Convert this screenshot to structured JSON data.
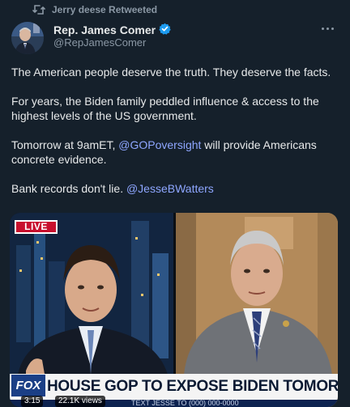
{
  "retweet": {
    "label": "Jerry deese Retweeted",
    "icon": "retweet-icon"
  },
  "author": {
    "name": "Rep. James Comer",
    "handle": "@RepJamesComer",
    "verified_icon": "verified-badge-icon",
    "verified_color": "#1d9bf0"
  },
  "tweet": {
    "paragraph1": "The American people deserve the truth. They deserve the facts.",
    "paragraph2": "For years, the Biden family peddled influence & access to the highest levels of the US government.",
    "paragraph3_prefix": "Tomorrow at 9amET, ",
    "paragraph3_mention": "@GOPoversight",
    "paragraph3_suffix": " will provide Americans concrete evidence.",
    "paragraph4_prefix": "Bank records don't lie. ",
    "paragraph4_mention": "@JesseBWatters"
  },
  "media": {
    "live_badge": "LIVE",
    "network_logo": "FOX",
    "chyron": "HOUSE GOP TO EXPOSE BIDEN TOMORROW",
    "ticker": "TEXT JESSE TO (000) 000-0000",
    "duration": "3:15",
    "views": "22.1K views"
  },
  "colors": {
    "background": "#15202b",
    "link": "#8ea6ff",
    "secondary_text": "#8b98a5",
    "live_red": "#c8102e"
  }
}
